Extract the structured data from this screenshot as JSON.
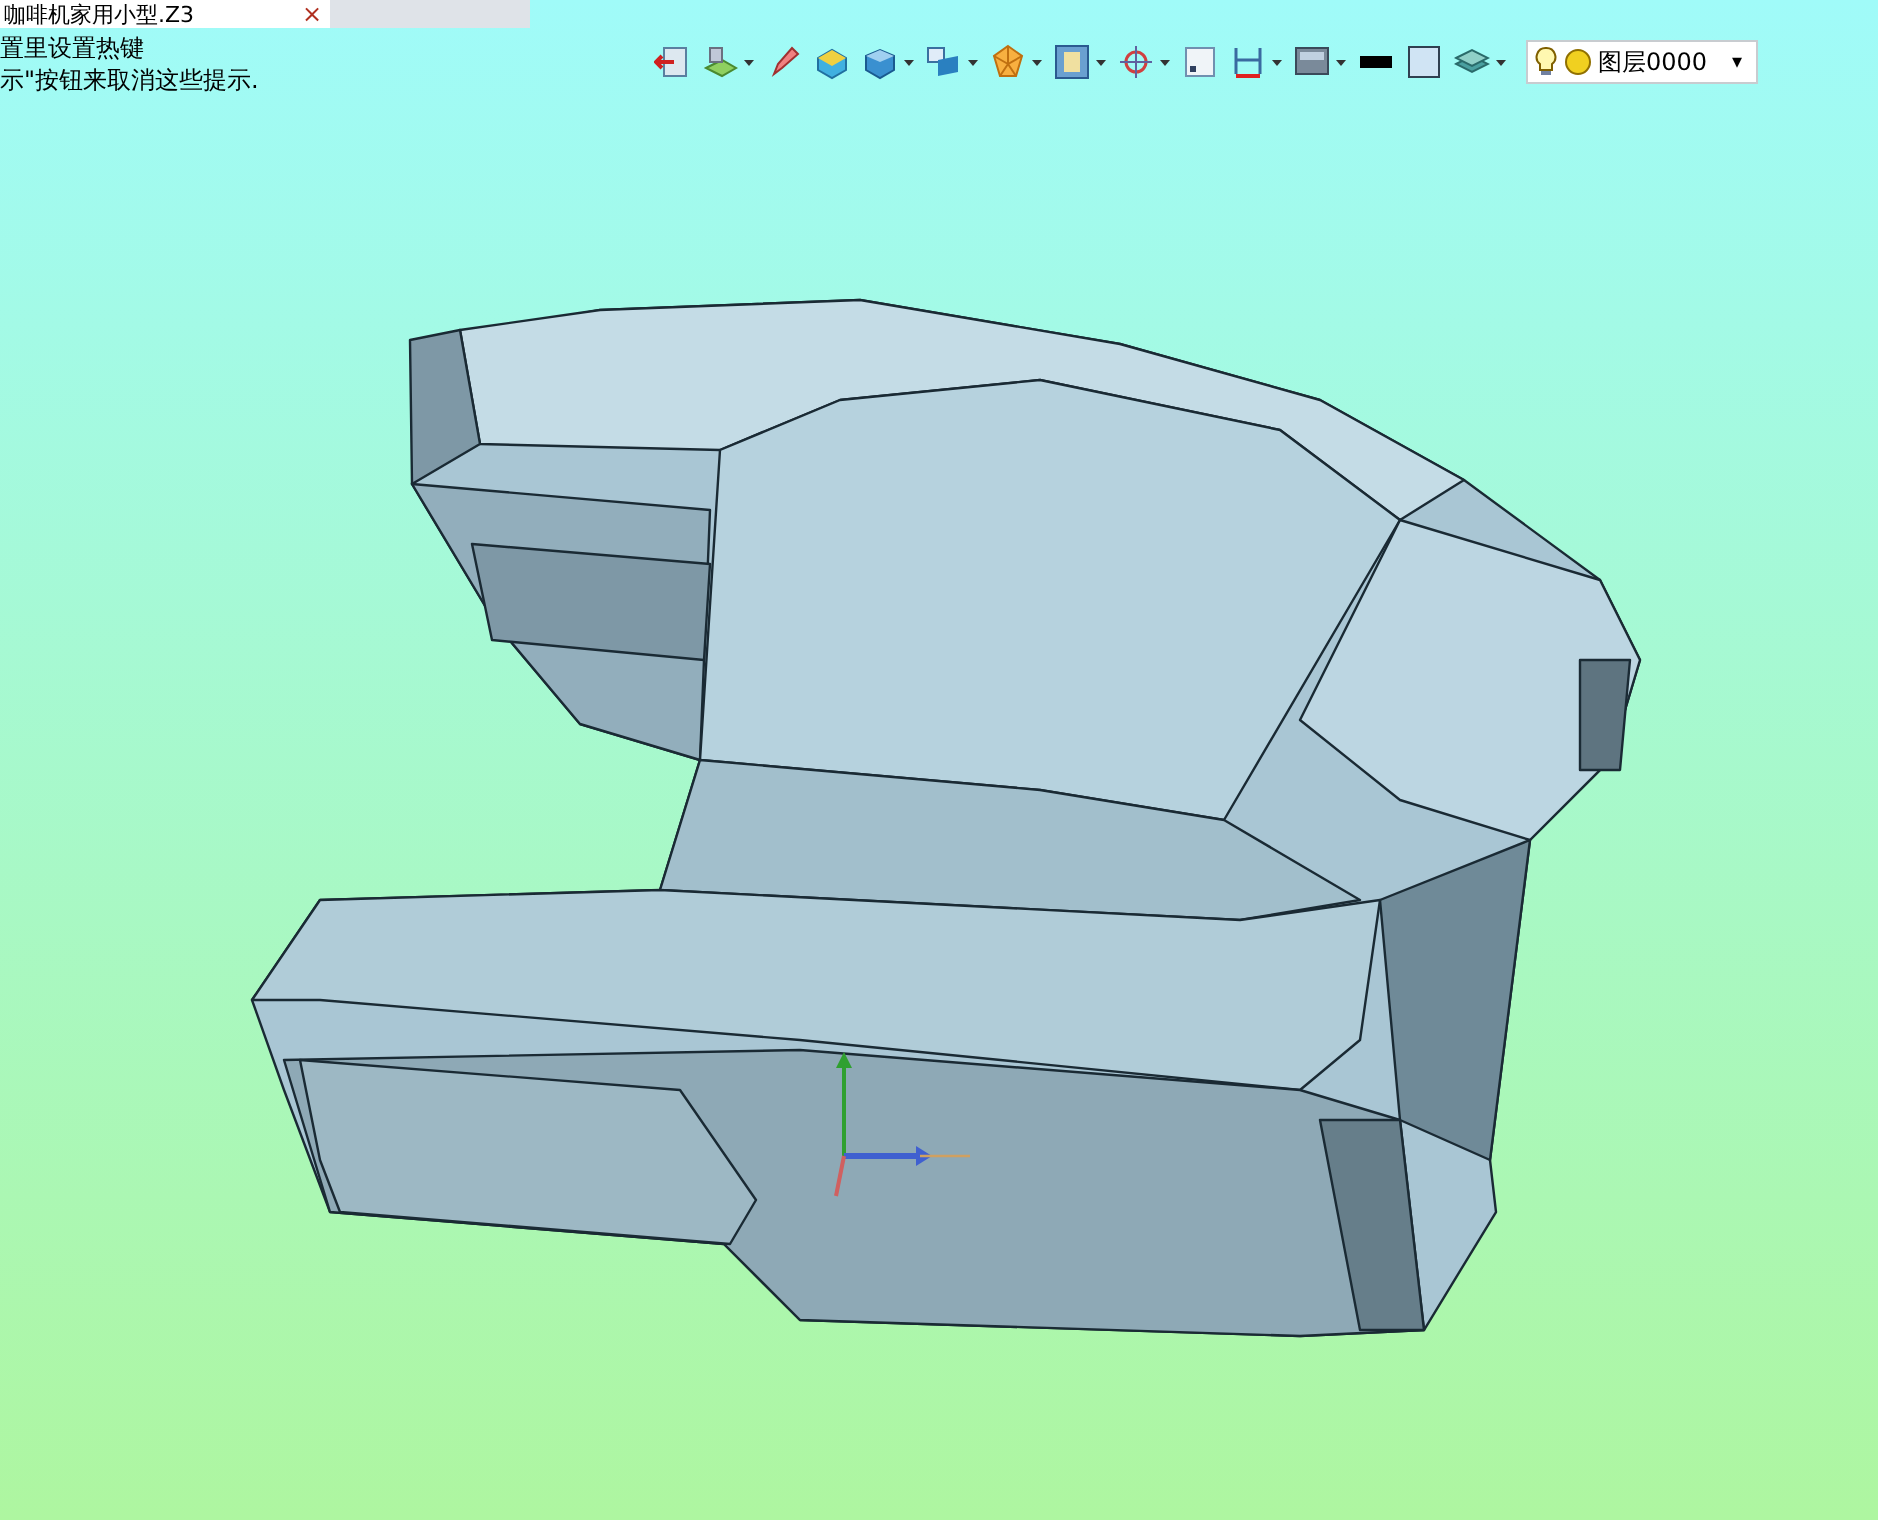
{
  "document_tab": {
    "title": "咖啡机家用小型.Z3",
    "close": "×"
  },
  "hints": [
    "置里设置热键",
    "示\"按钮来取消这些提示."
  ],
  "toolbar": [
    {
      "kind": "exit",
      "dropdown": false
    },
    {
      "kind": "sketch",
      "dropdown": true
    },
    {
      "kind": "pencil",
      "dropdown": false
    },
    {
      "kind": "box",
      "dropdown": false
    },
    {
      "kind": "cube",
      "dropdown": true
    },
    {
      "kind": "view",
      "dropdown": true
    },
    {
      "kind": "polygon",
      "dropdown": true
    },
    {
      "kind": "frame",
      "dropdown": true
    },
    {
      "kind": "target",
      "dropdown": true
    },
    {
      "kind": "small-frame",
      "dropdown": false
    },
    {
      "kind": "dimension",
      "dropdown": true
    },
    {
      "kind": "monitor",
      "dropdown": true
    },
    {
      "kind": "black-bar",
      "dropdown": false
    },
    {
      "kind": "square",
      "dropdown": false
    },
    {
      "kind": "layers",
      "dropdown": true
    }
  ],
  "layer_selector": {
    "value": "图层0000",
    "caret": "▾"
  }
}
